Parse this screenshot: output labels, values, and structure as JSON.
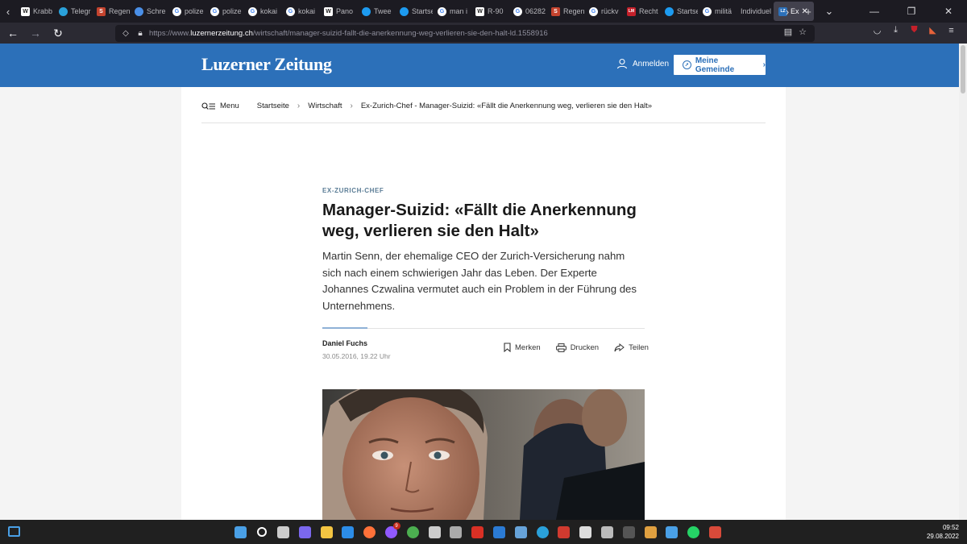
{
  "browser": {
    "tabs": [
      {
        "title": "Krabb",
        "icon": "wikipedia-icon",
        "color": "#ffffff"
      },
      {
        "title": "Telegr",
        "icon": "telegram-icon",
        "color": "#2aa1da"
      },
      {
        "title": "Regen",
        "icon": "scribd-icon",
        "color": "#c4432e"
      },
      {
        "title": "Schre",
        "icon": "infinity-icon",
        "color": "#4a8fe7"
      },
      {
        "title": "polize",
        "icon": "google-icon",
        "color": "#ffffff"
      },
      {
        "title": "polize",
        "icon": "google-icon",
        "color": "#ffffff"
      },
      {
        "title": "kokai",
        "icon": "google-icon",
        "color": "#ffffff"
      },
      {
        "title": "kokai",
        "icon": "google-icon",
        "color": "#ffffff"
      },
      {
        "title": "Pano",
        "icon": "wikipedia-icon",
        "color": "#ffffff"
      },
      {
        "title": "Twee",
        "icon": "twitter-icon",
        "color": "#1d9bf0"
      },
      {
        "title": "Startse",
        "icon": "twitter-icon",
        "color": "#1d9bf0"
      },
      {
        "title": "man i",
        "icon": "google-icon",
        "color": "#ffffff"
      },
      {
        "title": "R-90",
        "icon": "wikipedia-icon",
        "color": "#ffffff"
      },
      {
        "title": "06282",
        "icon": "google-icon",
        "color": "#ffffff"
      },
      {
        "title": "Regen",
        "icon": "scribd-icon",
        "color": "#c4432e"
      },
      {
        "title": "rückv",
        "icon": "google-icon",
        "color": "#ffffff"
      },
      {
        "title": "Recht",
        "icon": "lm-icon",
        "color": "#c4202a"
      },
      {
        "title": "Startse",
        "icon": "twitter-icon",
        "color": "#1d9bf0"
      },
      {
        "title": "militä",
        "icon": "google-icon",
        "color": "#ffffff"
      },
      {
        "title": "Individuel",
        "icon": "",
        "color": ""
      },
      {
        "title": "Ex",
        "icon": "lz-icon",
        "color": "#2c70b9",
        "active": true
      }
    ],
    "url_prefix": "https://www.",
    "url_host": "luzernerzeitung.ch",
    "url_path": "/wirtschaft/manager-suizid-fallt-die-anerkennung-weg-verlieren-sie-den-halt-ld.1558916"
  },
  "site": {
    "logo": "Luzerner Zeitung",
    "login_label": "Anmelden",
    "gemeinde_label": "Meine Gemeinde",
    "brand_color": "#2c70b9"
  },
  "breadcrumb": {
    "menu_label": "Menu",
    "items": [
      "Startseite",
      "Wirtschaft",
      "Ex-Zurich-Chef - Manager-Suizid: «Fällt die Anerkennung weg, verlieren sie den Halt»"
    ]
  },
  "article": {
    "kicker": "EX-ZURICH-CHEF",
    "headline": "Manager-Suizid: «Fällt die Anerkennung weg, verlieren sie den Halt»",
    "lead": "Martin Senn, der ehemalige CEO der Zurich-Versicherung nahm sich nach einem schwierigen Jahr das Leben. Der Experte Johannes Czwalina vermutet auch ein Problem in der Führung des Unternehmens.",
    "author": "Daniel Fuchs",
    "date": "30.05.2016, 19.22 Uhr",
    "actions": {
      "save": "Merken",
      "print": "Drucken",
      "share": "Teilen"
    }
  },
  "taskbar": {
    "time": "09:52",
    "date": "29.08.2022",
    "apps": [
      {
        "name": "start-icon",
        "color": "#4aa0e6"
      },
      {
        "name": "search-icon",
        "color": "#ffffff"
      },
      {
        "name": "task-view-icon",
        "color": "#cccccc"
      },
      {
        "name": "chat-icon",
        "color": "#7b68ee"
      },
      {
        "name": "file-explorer-icon",
        "color": "#f4c542"
      },
      {
        "name": "security-icon",
        "color": "#2c8de8"
      },
      {
        "name": "firefox-icon",
        "color": "#ff7139"
      },
      {
        "name": "firefox-dev-icon",
        "color": "#9059ff",
        "badge": "9"
      },
      {
        "name": "chrome-icon",
        "color": "#4caf50"
      },
      {
        "name": "live-icon",
        "color": "#cccccc"
      },
      {
        "name": "camera-icon",
        "color": "#aaaaaa"
      },
      {
        "name": "media-icon",
        "color": "#d93025"
      },
      {
        "name": "powershell-icon",
        "color": "#2b7bd5"
      },
      {
        "name": "mail-icon",
        "color": "#67a3d9"
      },
      {
        "name": "telegram-icon",
        "color": "#2aa1da"
      },
      {
        "name": "news-icon",
        "color": "#d03a2f"
      },
      {
        "name": "grid-app-icon",
        "color": "#dddddd"
      },
      {
        "name": "printer-icon",
        "color": "#bbbbbb"
      },
      {
        "name": "terminal-icon",
        "color": "#555555"
      },
      {
        "name": "library-icon",
        "color": "#e0a040"
      },
      {
        "name": "notes-icon",
        "color": "#4aa0e6"
      },
      {
        "name": "whatsapp-icon",
        "color": "#25d366"
      },
      {
        "name": "snipping-icon",
        "color": "#d84a3a"
      }
    ]
  }
}
